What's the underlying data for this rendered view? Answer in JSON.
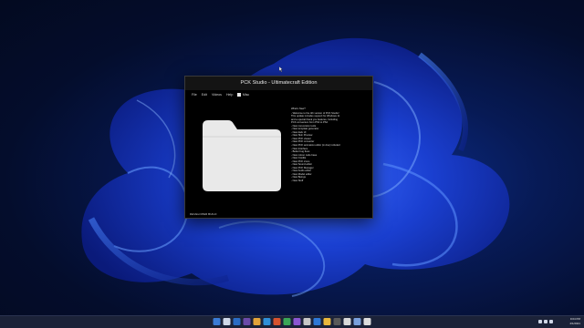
{
  "window": {
    "title": "PCK Studio - Ultimatecraft Edition",
    "menu": [
      "File",
      "Edit",
      "Videos",
      "Help"
    ],
    "menu_checkbox_label": "Misc",
    "status_text": "DEVELOPER BUILD"
  },
  "changelog": {
    "heading": "What's New?",
    "lines": [
      "- Welcome to the 4th version of PCK Studio!",
      "  This update includes support for Windows 11",
      "  and a special thank you features. Including",
      "  PCK conversion from PS3 to PS4",
      "- New conversion tools",
      "- New template generator",
      "- New dark UI",
      "- New Skin Preview",
      "- New PCK viewer",
      "- New PCK converter",
      "- New PCK animation editor (in-line) included",
      "- New Interface",
      "- Better bug fixes",
      "- New colour code base",
      "- New Credits",
      "- New PCK icons",
      "- New Sound editor",
      "- New PCK Manager",
      "- New Audio editor",
      "- New Model editor",
      "- New Beings",
      "- New Stuff"
    ]
  },
  "taskbar": {
    "icon_colors": [
      "#3a7bd5",
      "#cfd8e8",
      "#2b6cc4",
      "#6b4aa8",
      "#e2a33a",
      "#2f8fd8",
      "#d6532f",
      "#3aa657",
      "#8a56d1",
      "#c7c7c7",
      "#2e78d6",
      "#e9b73c",
      "#5a5a5a",
      "#d9d9d9",
      "#7aa0dc",
      "#dcdcdc"
    ],
    "time": "9:04 PM",
    "date": "4/1/2021"
  },
  "accent": "#1a4ad8"
}
